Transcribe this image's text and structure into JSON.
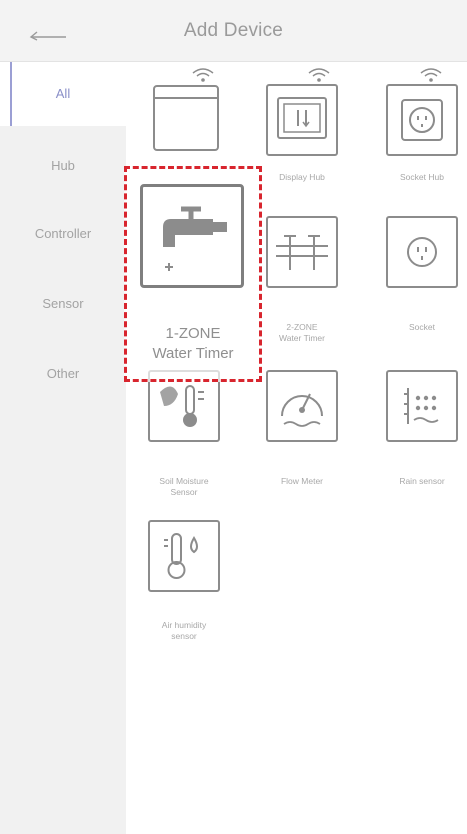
{
  "header": {
    "title": "Add Device"
  },
  "sidebar": {
    "items": [
      {
        "label": "All",
        "active": true
      },
      {
        "label": "Hub",
        "active": false
      },
      {
        "label": "Controller",
        "active": false
      },
      {
        "label": "Sensor",
        "active": false
      },
      {
        "label": "Other",
        "active": false
      }
    ]
  },
  "devices": [
    {
      "label": "",
      "icon": "window-hub-icon"
    },
    {
      "label": "Display Hub",
      "icon": "display-hub-icon"
    },
    {
      "label": "Socket Hub",
      "icon": "socket-hub-icon"
    },
    {
      "label": "1-ZONE Water Timer",
      "line1": "1-ZONE",
      "line2": "Water Timer",
      "icon": "faucet-icon",
      "selected": true
    },
    {
      "label": "2-ZONE Water Timer",
      "line1": "2-ZONE",
      "line2": "Water Timer",
      "icon": "dual-valve-icon"
    },
    {
      "label": "Socket",
      "icon": "socket-icon"
    },
    {
      "label": "Soil Moisture Sensor",
      "line1": "Soil Moisture",
      "line2": "Sensor",
      "icon": "soil-thermometer-icon"
    },
    {
      "label": "Flow Meter",
      "icon": "gauge-icon"
    },
    {
      "label": "Rain sensor",
      "icon": "rain-sensor-icon"
    },
    {
      "label": "Air humidity sensor",
      "line1": "Air humidity",
      "line2": "sensor",
      "icon": "humidity-thermometer-icon"
    }
  ],
  "colors": {
    "accent": "#8a8fc8",
    "selection": "#d8252e",
    "sidebar_bg": "#f1f1f1",
    "icon_stroke": "#8c8c8c"
  }
}
